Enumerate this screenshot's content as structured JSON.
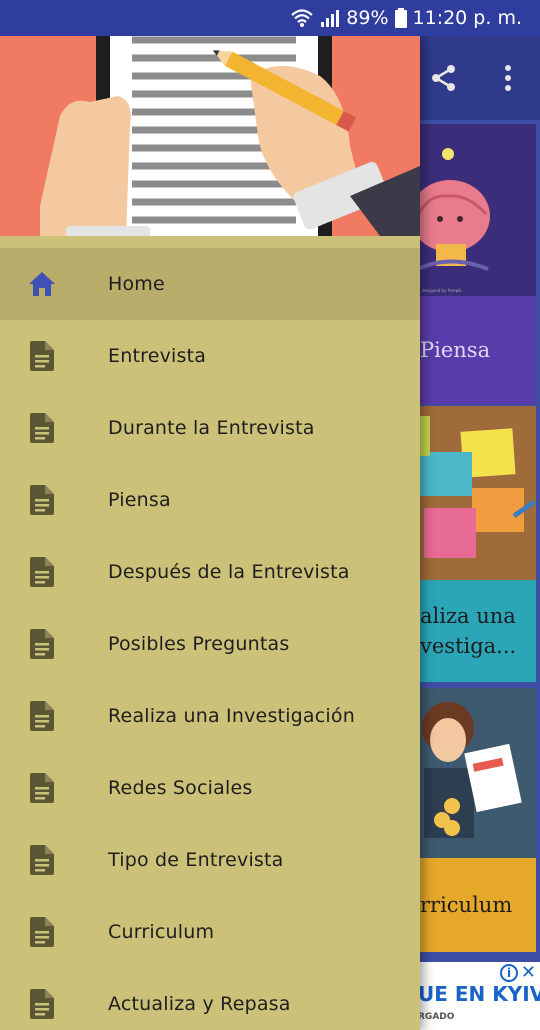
{
  "status_bar": {
    "battery_percent": "89%",
    "time": "11:20 p. m."
  },
  "background": {
    "cards": [
      {
        "label": "Piensa"
      },
      {
        "label": "aliza una\nvestiga..."
      },
      {
        "label": "rriculum"
      }
    ],
    "ad": {
      "headline": "UE EN KYIV",
      "subtext": "RGADO",
      "info_icon": "info-icon",
      "close_icon": "close-icon"
    }
  },
  "drawer": {
    "header_image": "hands-writing-on-paper-illustration",
    "items": [
      {
        "label": "Home",
        "icon": "home-icon",
        "active": true
      },
      {
        "label": "Entrevista",
        "icon": "document-icon"
      },
      {
        "label": "Durante la Entrevista",
        "icon": "document-icon"
      },
      {
        "label": "Piensa",
        "icon": "document-icon"
      },
      {
        "label": "Después de la Entrevista",
        "icon": "document-icon"
      },
      {
        "label": "Posibles Preguntas",
        "icon": "document-icon"
      },
      {
        "label": "Realiza una Investigación",
        "icon": "document-icon"
      },
      {
        "label": "Redes Sociales",
        "icon": "document-icon"
      },
      {
        "label": "Tipo de Entrevista",
        "icon": "document-icon"
      },
      {
        "label": "Curriculum",
        "icon": "document-icon"
      },
      {
        "label": "Actualiza y Repasa",
        "icon": "document-icon"
      }
    ]
  },
  "colors": {
    "status_bar": "#2f3e9e",
    "drawer_bg": "#ccc178",
    "drawer_active": "#b8ad6a",
    "home_icon": "#3f51b5",
    "doc_icon": "#5b5634",
    "header_bg": "#f07a62"
  }
}
